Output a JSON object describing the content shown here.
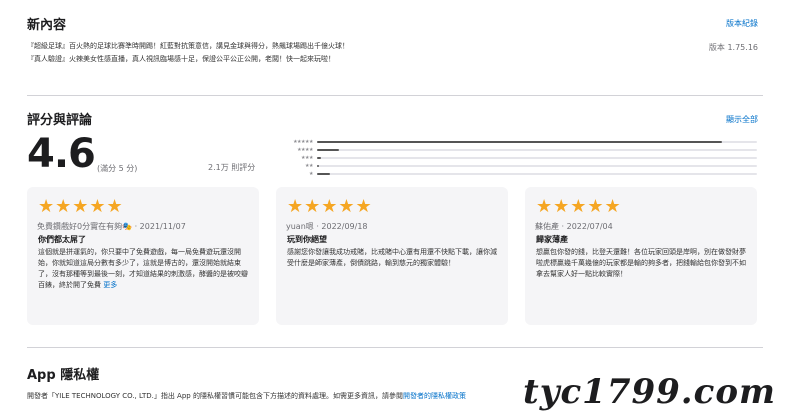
{
  "whats_new": {
    "title": "新內容",
    "version_history_link": "版本紀錄",
    "lines": [
      "『超級足球』百火熱的足球比賽準時開踢！紅藍對抗策意信，講見金球與得分，熱飆球場踢出千億火球！",
      "『真人驗證』火辣美女性感直播，真人視訊臨場感十足，保證公平公正公開，老闆！快一起來玩啦！"
    ],
    "version": "版本 1.75.16"
  },
  "ratings": {
    "title": "評分與評論",
    "see_all_link": "顯示全部",
    "average": "4.6",
    "out_of": "(滿分 5 分)",
    "count": "2.1万 則評分",
    "histogram": [
      {
        "stars": "★★★★★",
        "fraction": 0.92
      },
      {
        "stars": "★★★★",
        "fraction": 0.05
      },
      {
        "stars": "★★★",
        "fraction": 0.01
      },
      {
        "stars": "★★",
        "fraction": 0.005
      },
      {
        "stars": "★",
        "fraction": 0.03
      }
    ]
  },
  "reviews": [
    {
      "rating": "★★★★★",
      "author_date": "免費鑽戲好0分實在有夠🎭 · 2021/11/07",
      "title": "你們都太屌了",
      "body": "這個就是拼運氣的，你只要中了免費遊戲，每一局免費遊玩還沒開始，你就知道這局分數有多少了，這就是博古的，還沒開始就結束了，沒有那種等到最後一刻，才知道結果的刺激感，酵醬的是被咬瓣百錶，終於開了免費",
      "more": "更多"
    },
    {
      "rating": "★★★★★",
      "author_date": "yuan嗯 · 2022/09/18",
      "title": "玩到你絕望",
      "body": "感謝您你發讓我成功戒賭，比戒賭中心還有用還不快點下載，讓你減受什麼是師家薄產，倒債跳路，輸到慈元的獨家體驗！",
      "more": ""
    },
    {
      "rating": "★★★★★",
      "author_date": "蘇佑產 · 2022/07/04",
      "title": "歸家薄產",
      "body": "想贏包你發的錢，比登天還難！各位玩家回頭是岸啊，別在做發財夢啦虎標贏幾千萬幾億的玩家都是輸的夠多者，把錢輸給包你發到不如拿去幫家人好一點比較實際！",
      "more": ""
    }
  ],
  "privacy": {
    "title": "App 隱私權",
    "text_prefix": "開發者「YILE TECHNOLOGY CO., LTD.」指出 App 的隱私權習慣可能包含下方描述的資料處理。如需更多資訊，請參閱",
    "text_link": "開發者的隱私權政策"
  },
  "watermark": "tyc1799.com"
}
